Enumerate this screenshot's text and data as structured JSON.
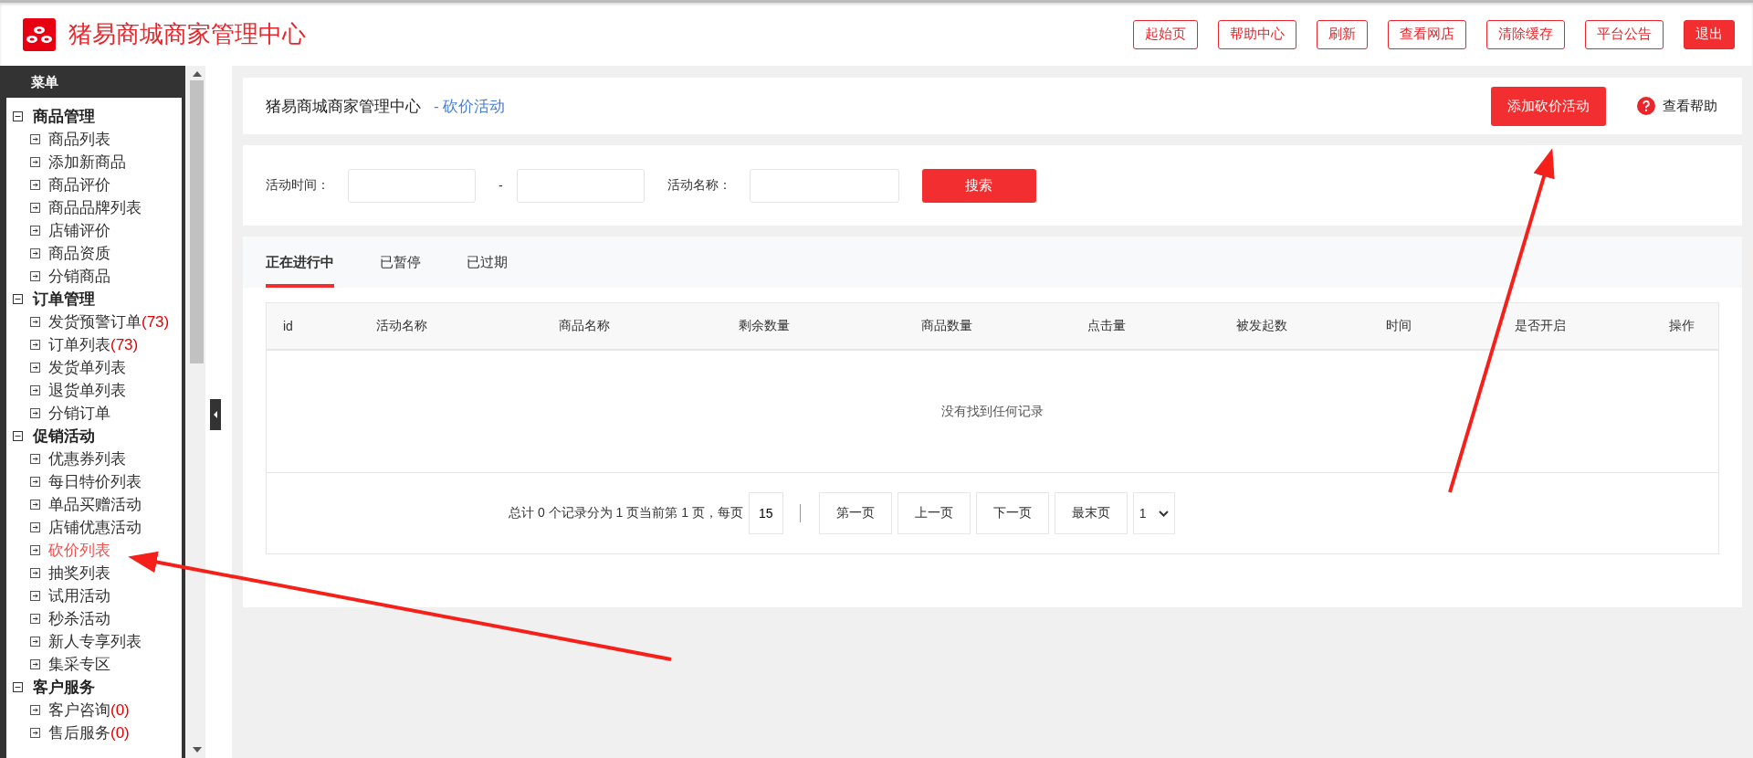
{
  "header": {
    "title": "猪易商城商家管理中心",
    "buttons": [
      {
        "label": "起始页",
        "kind": "outline"
      },
      {
        "label": "帮助中心",
        "kind": "outline"
      },
      {
        "label": "刷新",
        "kind": "outline"
      },
      {
        "label": "查看网店",
        "kind": "outline"
      },
      {
        "label": "清除缓存",
        "kind": "outline"
      },
      {
        "label": "平台公告",
        "kind": "outline"
      },
      {
        "label": "退出",
        "kind": "filled"
      }
    ]
  },
  "sidebar": {
    "title": "菜单",
    "groups": [
      {
        "label": "商品管理",
        "expanded": true,
        "children": [
          {
            "label": "商品列表",
            "selected": false
          },
          {
            "label": "添加新商品",
            "selected": false
          },
          {
            "label": "商品评价",
            "selected": false
          },
          {
            "label": "商品品牌列表",
            "selected": false
          },
          {
            "label": "店铺评价",
            "selected": false
          },
          {
            "label": "商品资质",
            "selected": false
          },
          {
            "label": "分销商品",
            "selected": false
          }
        ]
      },
      {
        "label": "订单管理",
        "expanded": true,
        "children": [
          {
            "label": "发货预警订单",
            "count": "(73)",
            "selected": false
          },
          {
            "label": "订单列表",
            "count": "(73)",
            "selected": false
          },
          {
            "label": "发货单列表",
            "selected": false
          },
          {
            "label": "退货单列表",
            "selected": false
          },
          {
            "label": "分销订单",
            "selected": false
          }
        ]
      },
      {
        "label": "促销活动",
        "expanded": true,
        "children": [
          {
            "label": "优惠券列表",
            "selected": false
          },
          {
            "label": "每日特价列表",
            "selected": false
          },
          {
            "label": "单品买赠活动",
            "selected": false
          },
          {
            "label": "店铺优惠活动",
            "selected": false
          },
          {
            "label": "砍价列表",
            "selected": true
          },
          {
            "label": "抽奖列表",
            "selected": false
          },
          {
            "label": "试用活动",
            "selected": false
          },
          {
            "label": "秒杀活动",
            "selected": false
          },
          {
            "label": "新人专享列表",
            "selected": false
          },
          {
            "label": "集采专区",
            "selected": false
          }
        ]
      },
      {
        "label": "客户服务",
        "expanded": true,
        "children": [
          {
            "label": "客户咨询",
            "count": "(0)",
            "selected": false
          },
          {
            "label": "售后服务",
            "count": "(0)",
            "selected": false
          }
        ]
      }
    ]
  },
  "breadcrumb": {
    "site": "猪易商城商家管理中心",
    "page": "- 砍价活动"
  },
  "add_button": "添加砍价活动",
  "help_link": "查看帮助",
  "filters": {
    "time_label": "活动时间：",
    "separator": "-",
    "name_label": "活动名称：",
    "search_button": "搜索"
  },
  "tabs": [
    {
      "label": "正在进行中",
      "selected": true
    },
    {
      "label": "已暂停",
      "selected": false
    },
    {
      "label": "已过期",
      "selected": false
    }
  ],
  "table": {
    "columns": [
      "id",
      "活动名称",
      "商品名称",
      "剩余数量",
      "商品数量",
      "点击量",
      "被发起数",
      "时间",
      "是否开启",
      "操作"
    ],
    "empty_message": "没有找到任何记录"
  },
  "pagination": {
    "summary": "总计 0 个记录分为 1 页当前第 1 页，每页",
    "page_size": "15",
    "buttons": [
      "第一页",
      "上一页",
      "下一页",
      "最末页"
    ],
    "page": "1"
  }
}
